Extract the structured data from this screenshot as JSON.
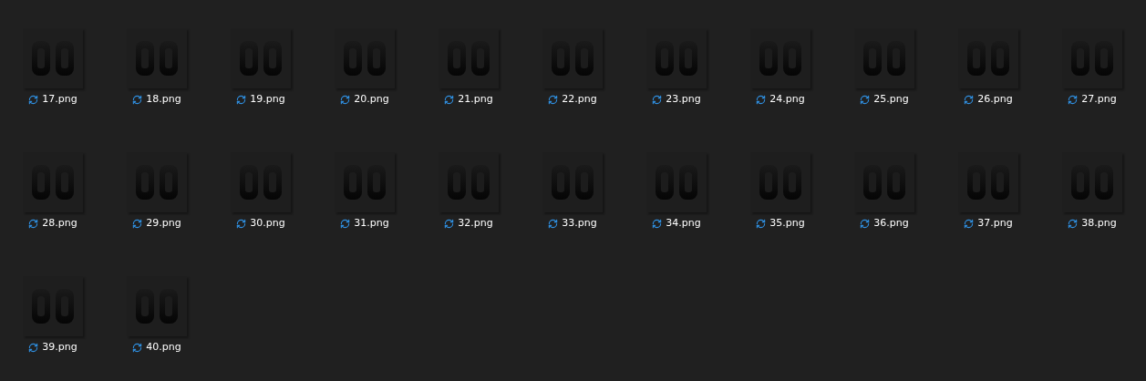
{
  "files": [
    {
      "name": "17.png"
    },
    {
      "name": "18.png"
    },
    {
      "name": "19.png"
    },
    {
      "name": "20.png"
    },
    {
      "name": "21.png"
    },
    {
      "name": "22.png"
    },
    {
      "name": "23.png"
    },
    {
      "name": "24.png"
    },
    {
      "name": "25.png"
    },
    {
      "name": "26.png"
    },
    {
      "name": "27.png"
    },
    {
      "name": "28.png"
    },
    {
      "name": "29.png"
    },
    {
      "name": "30.png"
    },
    {
      "name": "31.png"
    },
    {
      "name": "32.png"
    },
    {
      "name": "33.png"
    },
    {
      "name": "34.png"
    },
    {
      "name": "35.png"
    },
    {
      "name": "36.png"
    },
    {
      "name": "37.png"
    },
    {
      "name": "38.png"
    },
    {
      "name": "39.png"
    },
    {
      "name": "40.png"
    }
  ]
}
